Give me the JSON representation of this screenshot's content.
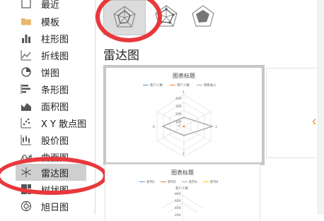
{
  "sidebar": {
    "items": [
      {
        "label": "最近",
        "icon": "recent-icon"
      },
      {
        "label": "模板",
        "icon": "folder-icon"
      },
      {
        "label": "柱形图",
        "icon": "column-chart-icon"
      },
      {
        "label": "折线图",
        "icon": "line-chart-icon"
      },
      {
        "label": "饼图",
        "icon": "pie-chart-icon"
      },
      {
        "label": "条形图",
        "icon": "bar-chart-icon"
      },
      {
        "label": "面积图",
        "icon": "area-chart-icon"
      },
      {
        "label": "X Y 散点图",
        "icon": "scatter-chart-icon"
      },
      {
        "label": "股价图",
        "icon": "stock-chart-icon"
      },
      {
        "label": "曲面图",
        "icon": "surface-chart-icon"
      },
      {
        "label": "雷达图",
        "icon": "radar-chart-icon"
      },
      {
        "label": "树状图",
        "icon": "treemap-chart-icon"
      },
      {
        "label": "旭日图",
        "icon": "sunburst-chart-icon"
      }
    ],
    "selected": "雷达图"
  },
  "subtypes": [
    {
      "icon": "radar-icon",
      "active": true
    },
    {
      "icon": "radar-with-markers-icon",
      "active": false
    },
    {
      "icon": "filled-radar-icon",
      "active": false
    }
  ],
  "section_title": "雷达图",
  "previews": [
    {
      "title": "图表标题",
      "legend": [
        {
          "label": "客户人数",
          "color": "#5b9bd5"
        },
        {
          "label": "用户人数",
          "color": "#ed7d31"
        },
        {
          "label": "销售收入",
          "color": "#a5a5a5"
        }
      ],
      "ticks": [
        "400",
        "300",
        "200",
        "100",
        "0"
      ],
      "axis_labels": [
        "1",
        "2",
        "3",
        "4",
        "6"
      ]
    },
    {
      "title": "图表标题",
      "legend": [
        {
          "label": "系列1",
          "color": "#5b9bd5"
        },
        {
          "label": "系列2",
          "color": "#ed7d31"
        },
        {
          "label": "系列3",
          "color": "#a5a5a5"
        },
        {
          "label": "系列4",
          "color": "#ffc000"
        }
      ],
      "ticks": [
        "800",
        "600",
        "400",
        "200"
      ],
      "axis_labels": [
        "客户人数"
      ]
    }
  ],
  "colors": {
    "highlight_ring": "#e8383d",
    "selected_bg": "#cfcfcf"
  }
}
